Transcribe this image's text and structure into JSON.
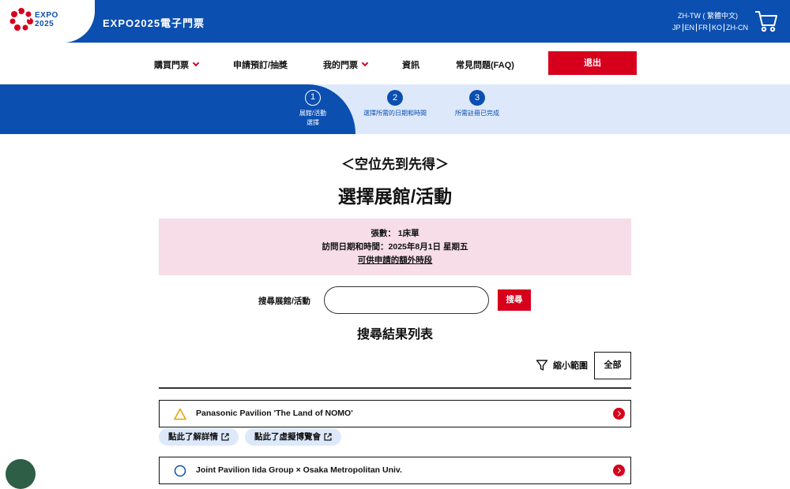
{
  "header": {
    "logo_text_top": "EXPO",
    "logo_text_bottom": "2025",
    "site_title": "EXPO2025電子門票",
    "lang_current": "ZH-TW ( 繁體中文)",
    "lang_options": [
      "JP",
      "EN",
      "FR",
      "KO",
      "ZH-CN"
    ],
    "cart_icon": "cart-icon"
  },
  "nav": {
    "items": [
      {
        "label": "購買門票",
        "has_dropdown": true
      },
      {
        "label": "申請預訂/抽獎",
        "has_dropdown": false
      },
      {
        "label": "我的門票",
        "has_dropdown": true
      },
      {
        "label": "資訊",
        "has_dropdown": false
      },
      {
        "label": "常見問題(FAQ)",
        "has_dropdown": false
      }
    ],
    "logout_label": "退出"
  },
  "steps": [
    {
      "num": "1",
      "label_line1": "展館/活動",
      "label_line2": "選擇",
      "active": true
    },
    {
      "num": "2",
      "label_line1": "選擇所需的日期和時間",
      "label_line2": "",
      "active": false
    },
    {
      "num": "3",
      "label_line1": "所需註冊已完成",
      "label_line2": "",
      "active": false
    }
  ],
  "page": {
    "subtitle": "＜空位先到先得＞",
    "title": "選擇展館/活動"
  },
  "info": {
    "count_line": "張數： 1床單",
    "date_line": "訪問日期和時間：2025年8月1日 星期五",
    "link_text": "可供申請的額外時段"
  },
  "search": {
    "label": "搜尋展館/活動",
    "input_value": "",
    "input_placeholder": "",
    "button_label": "搜尋"
  },
  "results": {
    "heading": "搜尋結果列表",
    "filter_label": "縮小範圍",
    "all_label": "全部",
    "items": [
      {
        "name": "Panasonic Pavilion 'The Land of NOMO'",
        "status_symbol": "triangle",
        "status_color": "#e8a200"
      },
      {
        "name": "Joint Pavilion Iida Group × Osaka Metropolitan Univ.",
        "status_symbol": "circle",
        "status_color": "#0b4fb0"
      }
    ],
    "detail_link": "點此了解詳情",
    "virtual_link": "點此了虛擬博覽會"
  },
  "colors": {
    "brand_blue": "#0b4fb0",
    "accent_red": "#d6001c",
    "info_pink": "#f6dde8",
    "light_blue": "#dde9fb"
  }
}
